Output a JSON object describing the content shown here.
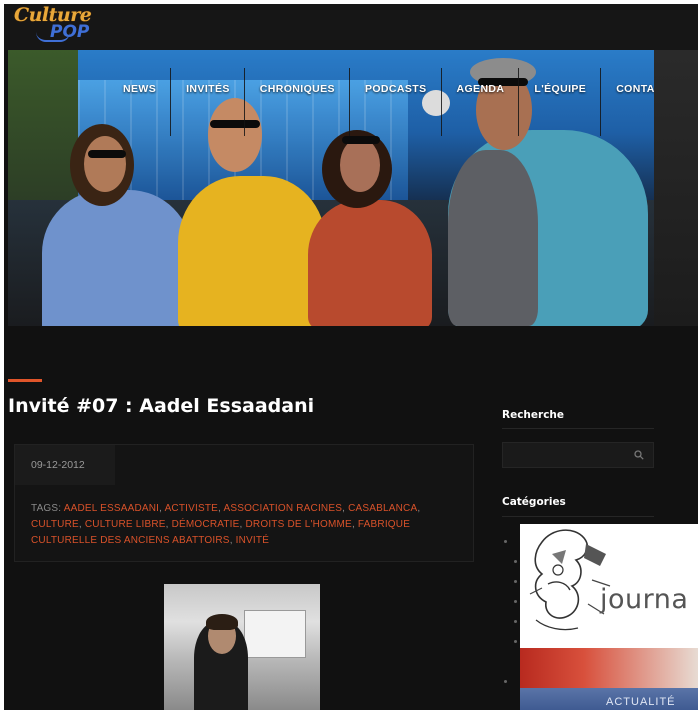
{
  "logo": {
    "line1": "Culture",
    "line2": "POP"
  },
  "nav": {
    "items": [
      "NEWS",
      "INVITÉS",
      "CHRONIQUES",
      "PODCASTS",
      "AGENDA",
      "L'ÉQUIPE",
      "CONTACT"
    ]
  },
  "article": {
    "title": "Invité #07 : Aadel Essaadani",
    "date": "09-12-2012",
    "tags_label": "TAGS:",
    "tags": [
      "AADEL ESSAADANI",
      "ACTIVISTE",
      "ASSOCIATION RACINES",
      "CASABLANCA",
      "CULTURE",
      "CULTURE LIBRE",
      "DÉMOCRATIE",
      "DROITS DE L'HOMME",
      "FABRIQUE CULTURELLE DES ANCIENS ABATTOIRS",
      "INVITÉ"
    ]
  },
  "sidebar": {
    "search_heading": "Recherche",
    "categories_heading": "Catégories"
  },
  "ad": {
    "word": "journa",
    "band_text": "ACTUALITÉ"
  },
  "colors": {
    "accent": "#e0552a",
    "background": "#111111",
    "tag": "#d9522a"
  }
}
